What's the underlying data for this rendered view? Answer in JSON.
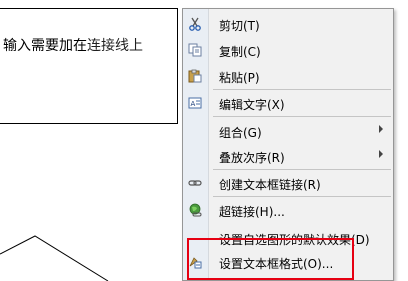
{
  "document": {
    "text_main": "输入需要加在",
    "text_link": "连接线上"
  },
  "context_menu": {
    "items": [
      {
        "label": "剪切(T)",
        "icon": "scissors-icon"
      },
      {
        "label": "复制(C)",
        "icon": "copy-icon"
      },
      {
        "label": "粘贴(P)",
        "icon": "paste-icon"
      },
      {
        "label": "编辑文字(X)",
        "icon": "edit-text-icon"
      },
      {
        "label": "组合(G)",
        "icon": "",
        "submenu": true
      },
      {
        "label": "叠放次序(R)",
        "icon": "",
        "submenu": true
      },
      {
        "label": "创建文本框链接(R)",
        "icon": "link-chain-icon"
      },
      {
        "label": "超链接(H)...",
        "icon": "globe-link-icon"
      },
      {
        "label": "设置自选图形的默认效果(D)",
        "icon": ""
      },
      {
        "label": "设置文本框格式(O)...",
        "icon": "format-textbox-icon"
      }
    ]
  },
  "colors": {
    "highlight": "#e60012",
    "menu_bg": "#f1f1f1",
    "gutter": "#e9eef4"
  }
}
